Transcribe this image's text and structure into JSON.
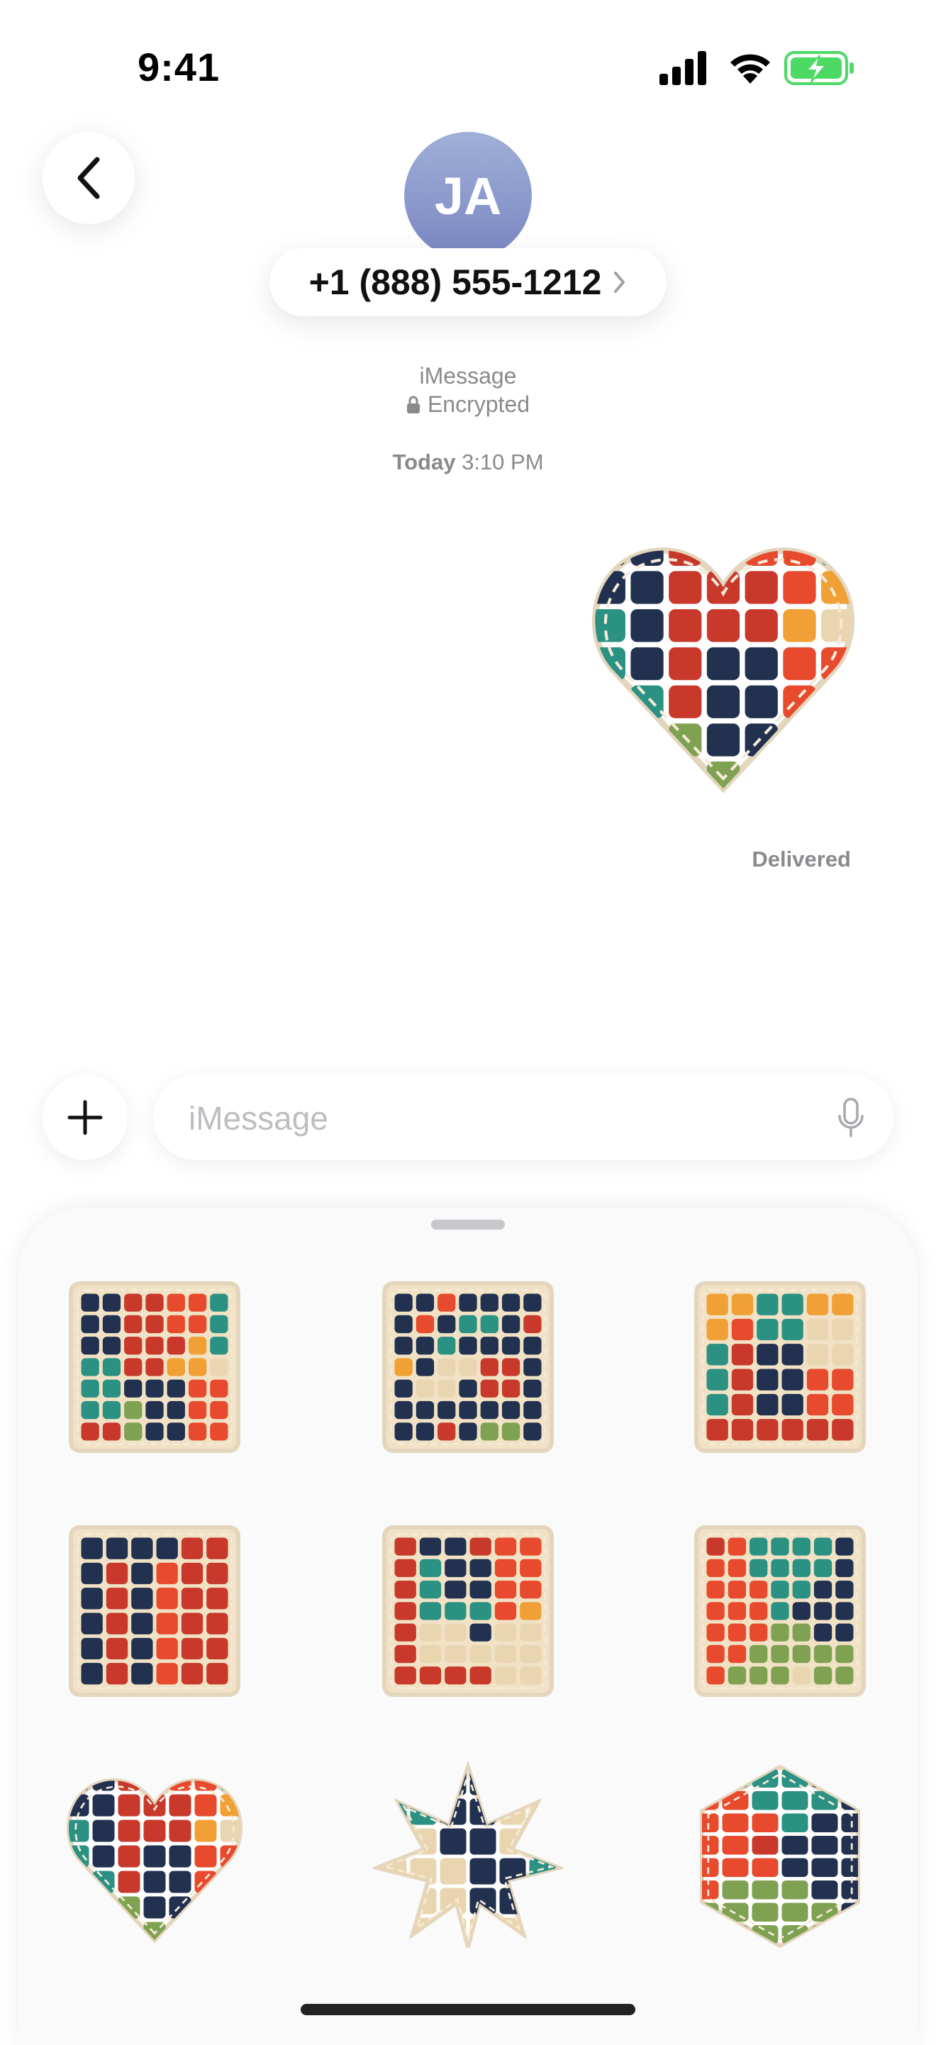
{
  "status_bar": {
    "time": "9:41",
    "icons": [
      "cellular-signal-icon",
      "wifi-icon",
      "battery-charging-icon"
    ],
    "battery_color": "#4cd964"
  },
  "header": {
    "back_icon": "chevron-left-icon",
    "avatar_initials": "JA",
    "contact_name": "+1 (888) 555-1212",
    "contact_chevron_icon": "chevron-right-icon"
  },
  "conversation": {
    "service": "iMessage",
    "encryption": "Encrypted",
    "lock_icon": "lock-icon",
    "timestamp_day": "Today",
    "timestamp_time": "3:10 PM",
    "sent_sticker": "heart-quilt-sticker",
    "delivery_status": "Delivered"
  },
  "compose": {
    "plus_icon": "plus-icon",
    "placeholder": "iMessage",
    "mic_icon": "microphone-icon"
  },
  "palette": {
    "navy": "#21314f",
    "red": "#c8392b",
    "orange": "#e84a2e",
    "gold": "#f0a035",
    "teal": "#2a9183",
    "green": "#7fa152",
    "cream": "#e9d6b0"
  },
  "sticker_drawer": {
    "stickers": [
      {
        "name": "sticker-square-quilt-1",
        "shape": "square",
        "rows": [
          "NNRROOT",
          "NNRROOT",
          "NNRRRGT",
          "TTRRGGC",
          "TTNNNOO",
          "TTGNNOO",
          "RRGNNOO"
        ]
      },
      {
        "name": "sticker-square-quilt-2",
        "shape": "square",
        "rows": [
          "NNONNNN",
          "NONTTNR",
          "NNTNNNN",
          "GNCCRRN",
          "NCCNRRN",
          "NNNNNNN",
          "NNRNGGN"
        ]
      },
      {
        "name": "sticker-square-quilt-3",
        "shape": "square",
        "rows": [
          "GGTTGG",
          "GOTTCC",
          "TRNNCC",
          "TRNNOO",
          "TRNNOO",
          "RRRRRR"
        ]
      },
      {
        "name": "sticker-square-quilt-4",
        "shape": "square",
        "rows": [
          "NNNNRR",
          "NRNORR",
          "NRNORR",
          "NRNORR",
          "NRNORR",
          "NRNORR"
        ]
      },
      {
        "name": "sticker-square-quilt-5",
        "shape": "square",
        "rows": [
          "RNNROO",
          "RTNNOO",
          "RTNNOO",
          "RTTTOG",
          "RCCNCC",
          "RCCCCC",
          "RRRRCC"
        ]
      },
      {
        "name": "sticker-square-quilt-6",
        "shape": "square",
        "rows": [
          "ROTTTTN",
          "OOTTTTN",
          "OOOTTNN",
          "OOOTNNN",
          "OOOGGNN",
          "OOGGGGG",
          "OGGGCGG"
        ]
      },
      {
        "name": "sticker-heart-quilt",
        "shape": "heart",
        "rows": [
          "NNRROOT",
          "NNRRROG",
          "TNRRRGC",
          "TNRNNOO",
          "TTRNNOO",
          "TTGNNNO",
          "TTGGNNN"
        ]
      },
      {
        "name": "sticker-star-quilt",
        "shape": "star",
        "rows": [
          "TTNNCC",
          "TTNNCC",
          "CCNNCC",
          "CCCNNT",
          "CCCNNC",
          "CCCCCC"
        ]
      },
      {
        "name": "sticker-hexagon-quilt",
        "shape": "hexagon",
        "rows": [
          "OTTTNN",
          "OOTTTN",
          "OOOTNN",
          "OORNNN",
          "OOONNN",
          "OGGGNN",
          "GGGGGN",
          "GGGGGG"
        ]
      }
    ]
  }
}
